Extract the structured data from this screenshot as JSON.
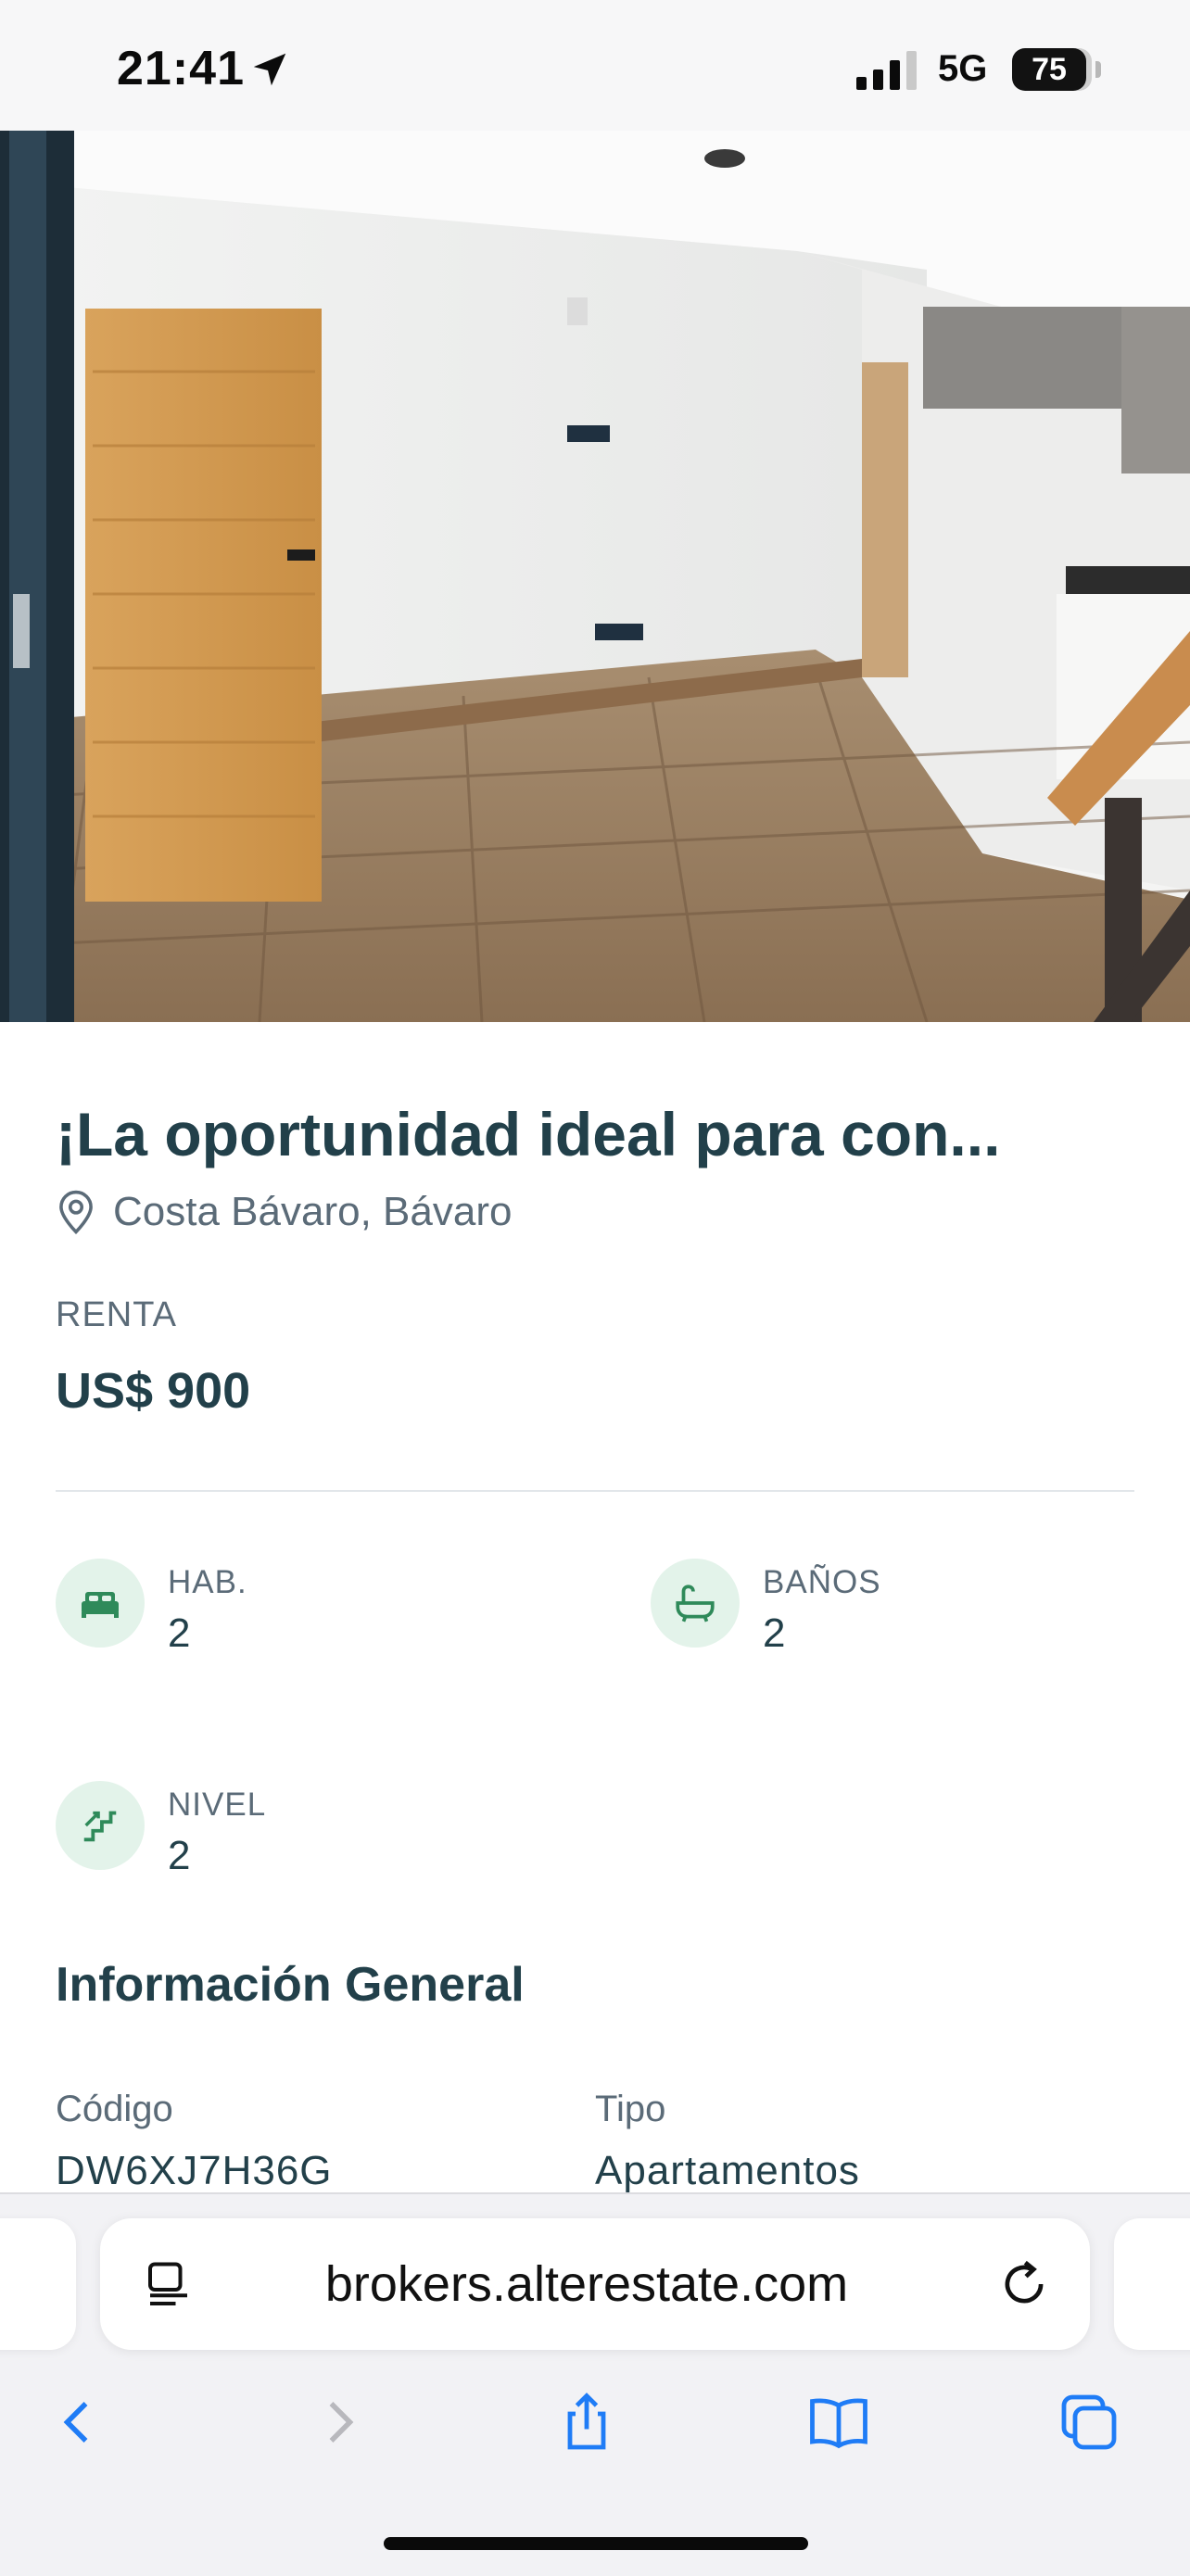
{
  "status_bar": {
    "time": "21:41",
    "network": "5G",
    "battery": "75"
  },
  "listing": {
    "title": "¡La oportunidad ideal para con...",
    "location": "Costa Bávaro, Bávaro",
    "price_label": "RENTA",
    "price": "US$ 900"
  },
  "features": [
    {
      "label": "HAB.",
      "value": "2",
      "icon": "bed-icon"
    },
    {
      "label": "BAÑOS",
      "value": "2",
      "icon": "bathtub-icon"
    },
    {
      "label": "NIVEL",
      "value": "2",
      "icon": "stairs-icon"
    }
  ],
  "general_info": {
    "title": "Información General",
    "fields": [
      {
        "label": "Código",
        "value": "DW6XJ7H36G"
      },
      {
        "label": "Tipo",
        "value": "Apartamentos"
      }
    ]
  },
  "browser": {
    "url": "brokers.alterestate.com",
    "toolbar": [
      "back-icon",
      "forward-icon",
      "share-icon",
      "bookmarks-icon",
      "tabs-icon"
    ]
  },
  "colors": {
    "accent": "#2f8a5a",
    "icon_bg": "#e3f3ea",
    "text_dark": "#22404a",
    "text_muted": "#5b6b78",
    "ios_blue": "#1f7cf6"
  }
}
